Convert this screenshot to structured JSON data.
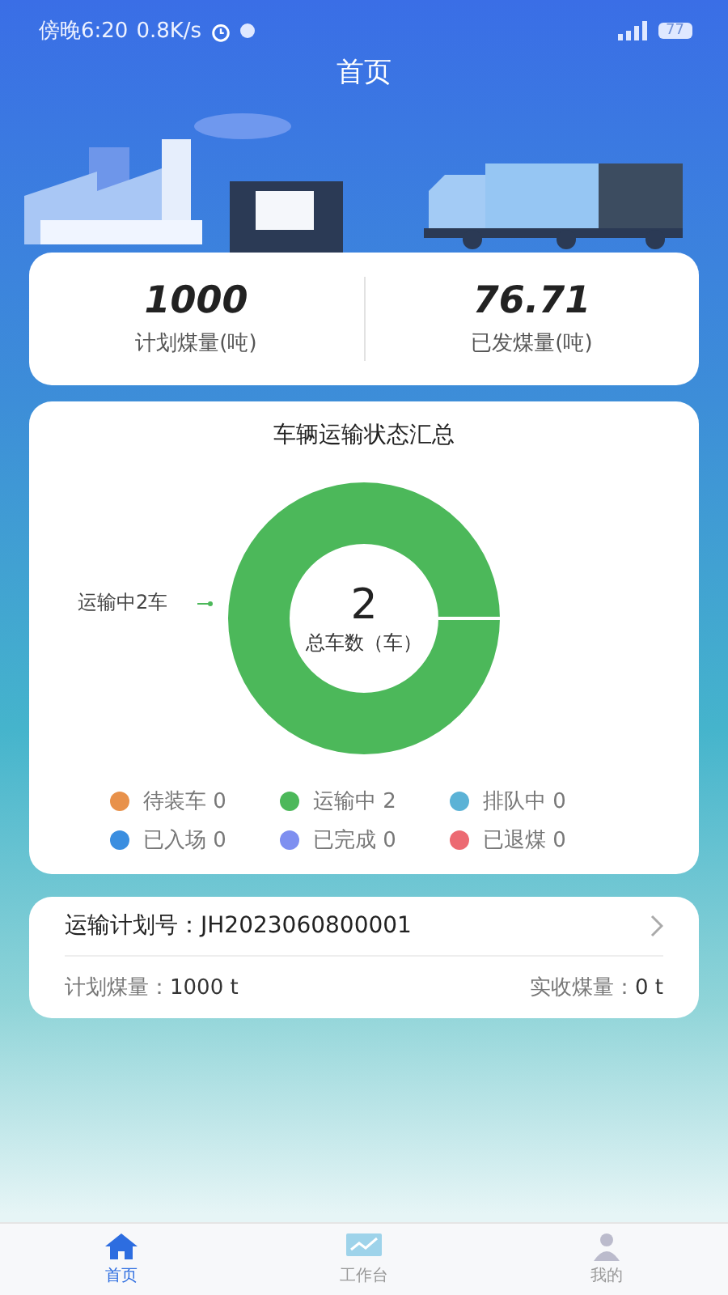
{
  "status_bar": {
    "time": "傍晚6:20",
    "speed": "0.8K/s",
    "battery": "77"
  },
  "header": {
    "title": "首页"
  },
  "summary": [
    {
      "value": "1000",
      "label": "计划煤量(吨)"
    },
    {
      "value": "76.71",
      "label": "已发煤量(吨)"
    }
  ],
  "status_card": {
    "title": "车辆运输状态汇总",
    "center_value": "2",
    "center_label": "总车数（车）",
    "callout": "运输中2车",
    "legend": [
      {
        "label": "待装车",
        "count": "0",
        "color": "#e8914a"
      },
      {
        "label": "运输中",
        "count": "2",
        "color": "#4cb85a"
      },
      {
        "label": "排队中",
        "count": "0",
        "color": "#5bb2d6"
      },
      {
        "label": "已入场",
        "count": "0",
        "color": "#3a8ee0"
      },
      {
        "label": "已完成",
        "count": "0",
        "color": "#7e8ff0"
      },
      {
        "label": "已退煤",
        "count": "0",
        "color": "#ec6a72"
      }
    ]
  },
  "plan": {
    "label": "运输计划号：",
    "number": "JH2023060800001",
    "planned_label": "计划煤量：",
    "planned": "1000 t",
    "received_label": "实收煤量：",
    "received": "0 t"
  },
  "tabs": [
    {
      "label": "首页",
      "selected": true
    },
    {
      "label": "工作台",
      "selected": false
    },
    {
      "label": "我的",
      "selected": false
    }
  ]
}
